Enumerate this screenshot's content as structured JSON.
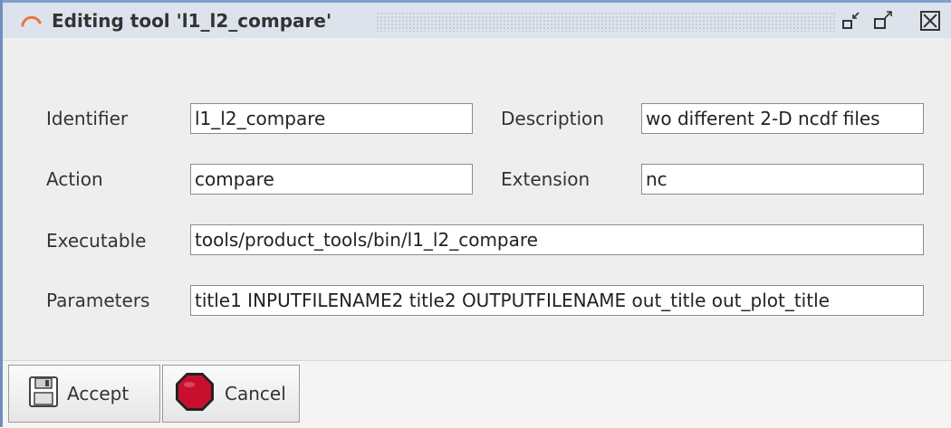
{
  "window": {
    "title": "Editing tool 'l1_l2_compare'",
    "icons": {
      "app": "spinner-arc-icon",
      "minimize": "minimize-window-icon",
      "maximize": "maximize-window-icon",
      "close": "close-window-icon"
    }
  },
  "form": {
    "identifier": {
      "label": "Identifier",
      "value": "l1_l2_compare"
    },
    "description": {
      "label": "Description",
      "value": "wo different 2-D ncdf files"
    },
    "action": {
      "label": "Action",
      "value": "compare"
    },
    "extension": {
      "label": "Extension",
      "value": "nc"
    },
    "executable": {
      "label": "Executable",
      "value": "tools/product_tools/bin/l1_l2_compare"
    },
    "parameters": {
      "label": "Parameters",
      "value": "title1 INPUTFILENAME2 title2 OUTPUTFILENAME out_title out_plot_title"
    }
  },
  "footer": {
    "accept": {
      "label": "Accept",
      "icon": "floppy-disk-icon"
    },
    "cancel": {
      "label": "Cancel",
      "icon": "stop-sign-icon"
    }
  },
  "colors": {
    "title_bar": "#dde3ec",
    "title_border": "#7f9fcf",
    "app_icon": "#e8753a",
    "stop_sign": "#c8102e",
    "panel": "#eeeeee"
  }
}
